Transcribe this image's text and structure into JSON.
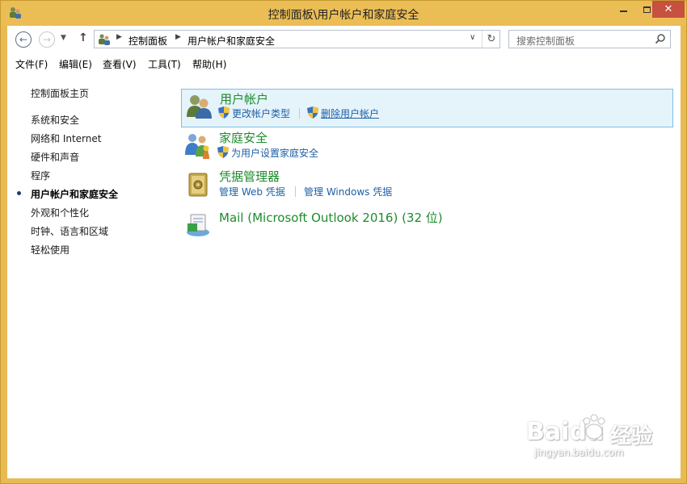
{
  "window": {
    "title": "控制面板\\用户帐户和家庭安全",
    "close_glyph": "✕"
  },
  "navigation": {
    "back_glyph": "←",
    "forward_glyph": "→",
    "recent_glyph": "▼",
    "up_glyph": "↑"
  },
  "address": {
    "breadcrumb": [
      "控制面板",
      "用户帐户和家庭安全"
    ],
    "separator_glyph": "▶",
    "dropdown_glyph": "∨",
    "refresh_glyph": "↻"
  },
  "search": {
    "placeholder": "搜索控制面板"
  },
  "menu": {
    "items": [
      "文件(F)",
      "编辑(E)",
      "查看(V)",
      "工具(T)",
      "帮助(H)"
    ]
  },
  "sidebar": {
    "home": "控制面板主页",
    "items": [
      "系统和安全",
      "网络和 Internet",
      "硬件和声音",
      "程序",
      "用户帐户和家庭安全",
      "外观和个性化",
      "时钟、语言和区域",
      "轻松使用"
    ],
    "current_index": 4
  },
  "sections": [
    {
      "title": "用户帐户",
      "icon": "users-icon",
      "tasks": [
        "更改帐户类型",
        "删除用户帐户"
      ]
    },
    {
      "title": "家庭安全",
      "icon": "family-safety-icon",
      "tasks": [
        "为用户设置家庭安全"
      ]
    },
    {
      "title": "凭据管理器",
      "icon": "credential-vault-icon",
      "tasks": [
        "管理 Web 凭据",
        "管理 Windows 凭据"
      ]
    },
    {
      "title": "Mail (Microsoft Outlook 2016) (32 位)",
      "icon": "mail-icon",
      "tasks": []
    }
  ],
  "watermark": {
    "brand": "Baidu",
    "product": "经验",
    "url": "jingyan.baidu.com"
  },
  "colors": {
    "frame": "#e9ba52",
    "link": "#1e5fa6",
    "section_title": "#1e8b2e",
    "selection_bg": "#e5f3fb",
    "selection_border": "#7cc0e4"
  }
}
